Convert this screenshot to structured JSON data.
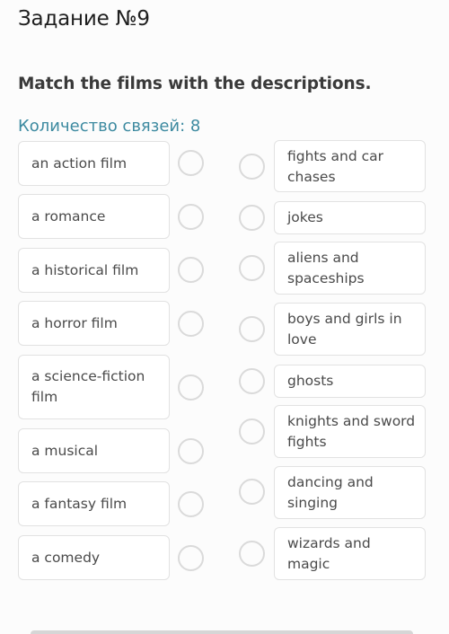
{
  "header": {
    "title": "Задание №9",
    "instruction": "Match the films with the descriptions.",
    "connections_label": "Количество связей: 8"
  },
  "left_items": [
    {
      "label": "an action film"
    },
    {
      "label": "a romance"
    },
    {
      "label": "a historical film"
    },
    {
      "label": "a horror film"
    },
    {
      "label": "a science-fiction film"
    },
    {
      "label": "a musical"
    },
    {
      "label": "a fantasy film"
    },
    {
      "label": "a comedy"
    }
  ],
  "right_items": [
    {
      "label": "fights and car chases"
    },
    {
      "label": "jokes"
    },
    {
      "label": "aliens and spaceships"
    },
    {
      "label": "boys and girls in love"
    },
    {
      "label": "ghosts"
    },
    {
      "label": "knights and sword fights"
    },
    {
      "label": "dancing and singing"
    },
    {
      "label": "wizards and magic"
    }
  ],
  "colors": {
    "accent": "#3d8aa0",
    "circle_border": "#dadada",
    "box_border": "#e2e2e2"
  }
}
